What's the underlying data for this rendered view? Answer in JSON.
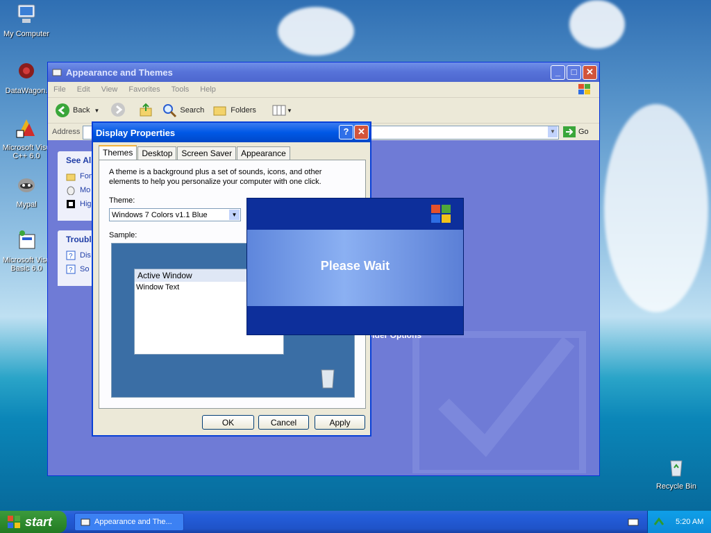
{
  "desktop": {
    "icons": [
      {
        "label": "My Computer",
        "icon": "computer-icon"
      },
      {
        "label": "DataWagon.",
        "icon": "datawagon-icon"
      },
      {
        "label": "Microsoft Visu C++ 6.0",
        "icon": "visual-cpp-icon"
      },
      {
        "label": "Mypal",
        "icon": "mypal-icon"
      },
      {
        "label": "Microsoft Visu Basic 6.0",
        "icon": "visual-basic-icon"
      },
      {
        "label": "Recycle Bin",
        "icon": "recycle-bin-icon"
      }
    ]
  },
  "explorer": {
    "title": "Appearance and Themes",
    "menu": [
      "File",
      "Edit",
      "View",
      "Favorites",
      "Tools",
      "Help"
    ],
    "toolbar": {
      "back": "Back",
      "search": "Search",
      "folders": "Folders"
    },
    "address_label": "Address",
    "go_label": "Go",
    "see_also": {
      "heading": "See Als",
      "items": [
        "Fon",
        "Mo",
        "Hig"
      ]
    },
    "troubleshooters": {
      "heading": "Troubl",
      "items": [
        "Dis",
        "So"
      ]
    },
    "bg_link": "older Options"
  },
  "display_properties": {
    "title": "Display Properties",
    "tabs": [
      "Themes",
      "Desktop",
      "Screen Saver",
      "Appearance"
    ],
    "active_tab": "Themes",
    "description": "A theme is a background plus a set of sounds, icons, and other elements to help you personalize your computer with one click.",
    "theme_label": "Theme:",
    "theme_value": "Windows 7 Colors v1.1 Blue",
    "sample_label": "Sample:",
    "sample_window_title": "Active Window",
    "sample_window_text": "Window Text",
    "buttons": {
      "ok": "OK",
      "cancel": "Cancel",
      "apply": "Apply"
    }
  },
  "please_wait": {
    "message": "Please Wait"
  },
  "taskbar": {
    "start_label": "start",
    "task_button": "Appearance and The...",
    "clock": "5:20 AM"
  },
  "colors": {
    "xp_blue": "#0058e6",
    "start_green": "#2f8b2f",
    "title_inactive": "#6f8fe8"
  }
}
